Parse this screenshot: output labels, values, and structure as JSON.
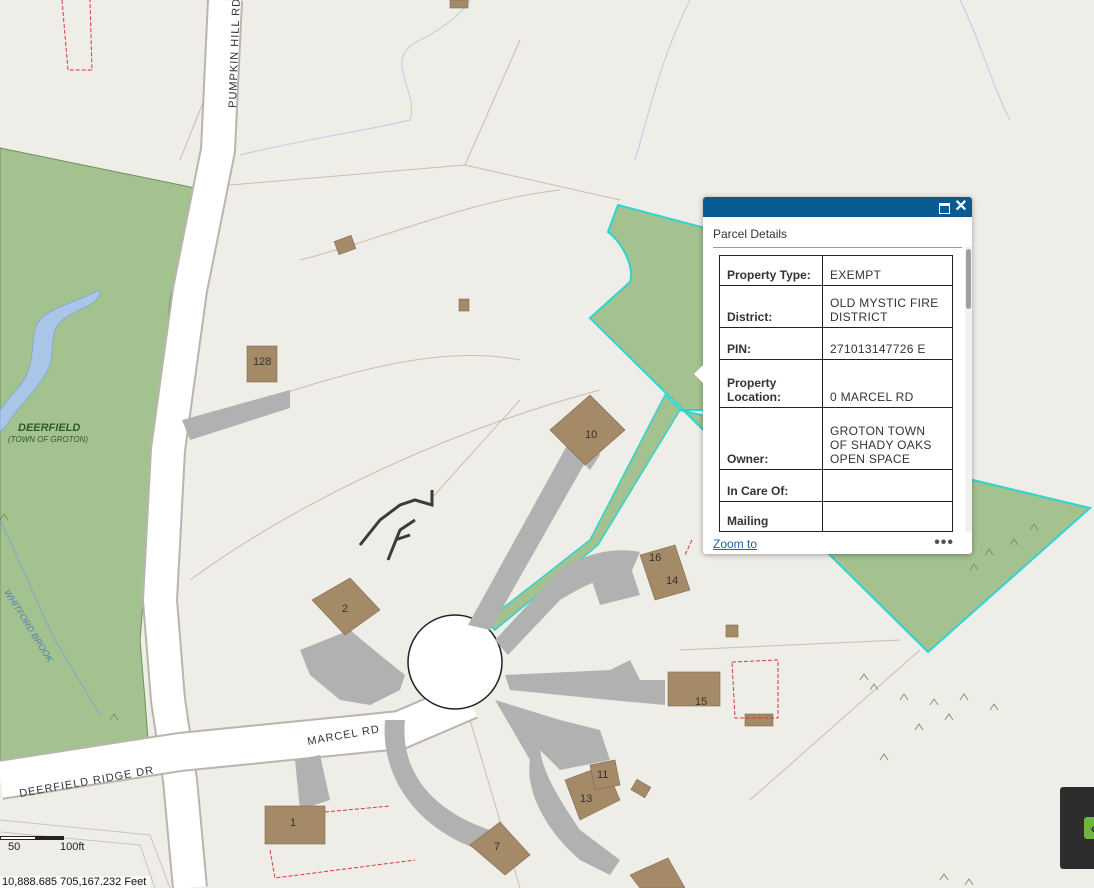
{
  "map": {
    "roads": {
      "pumpkin_hill": "PUMPKIN HILL RD",
      "marcel": "MARCEL RD",
      "deerfield_ridge": "DEERFIELD RIDGE DR"
    },
    "park": {
      "name": "DEERFIELD",
      "sub": "(TOWN OF GROTON)"
    },
    "stream_label": "WHITFORD BROOK",
    "lot_numbers": [
      "128",
      "10",
      "2",
      "16",
      "14",
      "15",
      "11",
      "13",
      "1",
      "7"
    ],
    "colors": {
      "background": "#efede7",
      "park_fill": "#a4c28f",
      "selected_outline": "#2fd4d0",
      "building": "#a48a67",
      "driveway": "#b1b1b1",
      "water": "#a9c6e8",
      "parcel_line_red": "#d93a3a",
      "popup_header": "#0b5b93"
    }
  },
  "popup": {
    "title": "Parcel Details",
    "rows": [
      {
        "label": "Property Type:",
        "value": "EXEMPT"
      },
      {
        "label": "District:",
        "value": "OLD MYSTIC FIRE DISTRICT"
      },
      {
        "label": "PIN:",
        "value": "271013147726 E"
      },
      {
        "label": "Property Location:",
        "value": "0 MARCEL RD"
      },
      {
        "label": "Owner:",
        "value": "GROTON TOWN OF SHADY OAKS OPEN SPACE"
      },
      {
        "label": "In Care Of:",
        "value": ""
      },
      {
        "label": "Mailing",
        "value": ""
      }
    ],
    "zoom_label": "Zoom to",
    "more_label": "•••",
    "maximize_icon": "maximize-icon",
    "close_icon": "close-icon",
    "close_label": "✕"
  },
  "scalebar": {
    "labels": [
      "50",
      "100ft"
    ]
  },
  "coordinates": "10,888.685 705,167.232 Feet",
  "widget": {
    "icon": "chevron-left-icon",
    "glyph": "‹"
  }
}
